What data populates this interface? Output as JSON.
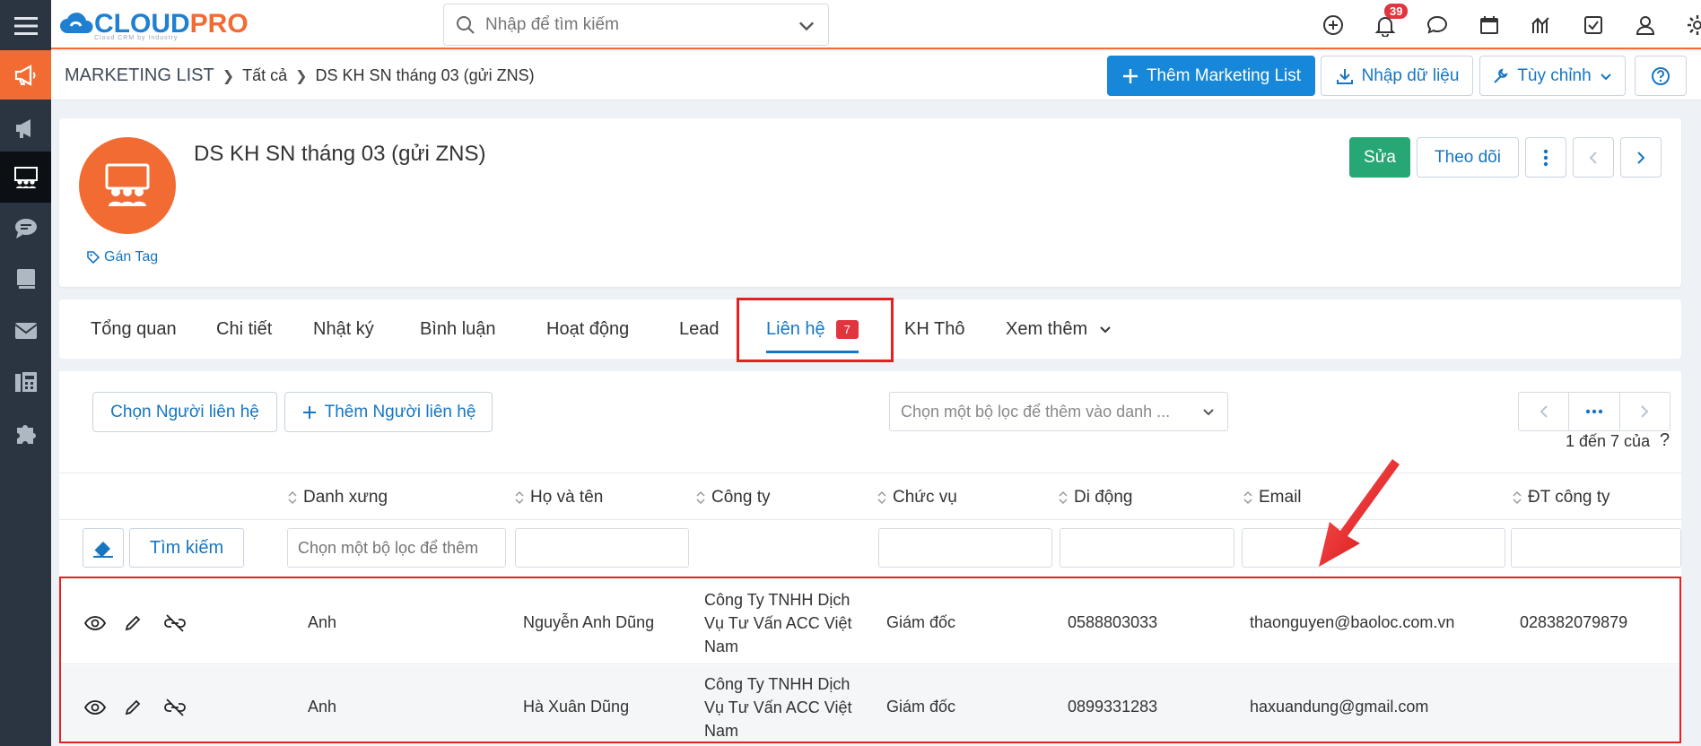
{
  "brand": {
    "logo_main": "CLOUD",
    "logo_accent": "PRO",
    "logo_tagline": "Cloud CRM by Industry",
    "accent_color": "#f26b33",
    "primary_color": "#1687d9"
  },
  "sidebar": {
    "items": [
      {
        "icon": "menu-icon"
      },
      {
        "icon": "megaphone-icon",
        "state": "marketing"
      },
      {
        "icon": "campaign-icon"
      },
      {
        "icon": "group-icon",
        "state": "active"
      },
      {
        "icon": "chat-icon"
      },
      {
        "icon": "book-icon"
      },
      {
        "icon": "mail-icon"
      },
      {
        "icon": "fax-icon"
      },
      {
        "icon": "puzzle-icon"
      }
    ]
  },
  "topbar": {
    "search_placeholder": "Nhập để tìm kiếm",
    "notification_count": "39",
    "icons": [
      "add-circle-icon",
      "bell-icon",
      "chat-bubble-icon",
      "calendar-icon",
      "chart-icon",
      "checkbox-icon",
      "user-icon",
      "settings-icon"
    ]
  },
  "breadcrumb": {
    "root": "MARKETING LIST",
    "level1": "Tất cả",
    "level2": "DS KH SN tháng 03 (gửi ZNS)"
  },
  "header_actions": {
    "add_label": "Thêm Marketing List",
    "import_label": "Nhập dữ liệu",
    "customize_label": "Tùy chỉnh"
  },
  "record": {
    "title": "DS KH SN tháng 03 (gửi ZNS)",
    "tag_label": "Gán Tag",
    "edit_label": "Sửa",
    "follow_label": "Theo dõi"
  },
  "tabs": [
    {
      "label": "Tổng quan"
    },
    {
      "label": "Chi tiết"
    },
    {
      "label": "Nhật ký"
    },
    {
      "label": "Bình luận"
    },
    {
      "label": "Hoạt động"
    },
    {
      "label": "Lead"
    },
    {
      "label": "Liên hệ",
      "count": "7",
      "active": true
    },
    {
      "label": "KH Thô"
    },
    {
      "label": "Xem thêm"
    }
  ],
  "related": {
    "select_label": "Chọn Người liên hệ",
    "add_label": "Thêm Người liên hệ",
    "filter_placeholder": "Chọn một bộ lọc để thêm vào danh ...",
    "pager_info": "1 đến 7 của",
    "help": "?",
    "search_button": "Tìm kiếm",
    "salutation_filter_placeholder": "Chọn một bộ lọc để thêm",
    "columns": [
      "Danh xưng",
      "Họ và tên",
      "Công ty",
      "Chức vụ",
      "Di động",
      "Email",
      "ĐT công ty"
    ],
    "rows": [
      {
        "salutation": "Anh",
        "name": "Nguyễn Anh Dũng",
        "company": "Công Ty TNHH Dịch Vụ Tư Vấn ACC Việt Nam",
        "title": "Giám đốc",
        "mobile": "0588803033",
        "email": "thaonguyen@baoloc.com.vn",
        "phone": "028382079879"
      },
      {
        "salutation": "Anh",
        "name": "Hà Xuân Dũng",
        "company": "Công Ty TNHH Dịch Vụ Tư Vấn ACC Việt Nam",
        "title": "Giám đốc",
        "mobile": "0899331283",
        "email": "haxuandung@gmail.com",
        "phone": ""
      }
    ]
  }
}
